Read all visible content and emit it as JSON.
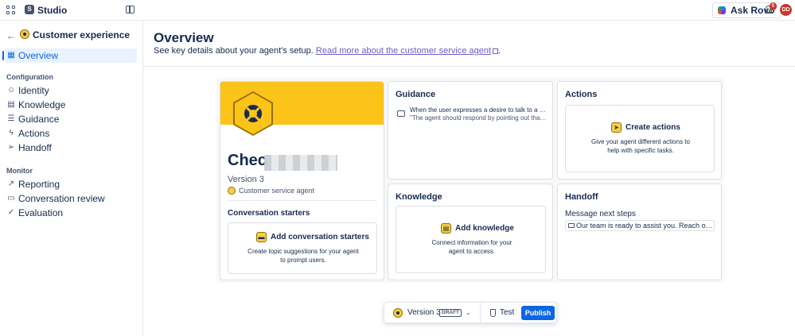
{
  "topbar": {
    "app_name": "Studio",
    "ask_rovo": "Ask Rovo",
    "notification_count": "6",
    "avatar_initials": "DD"
  },
  "sidebar": {
    "agent_name": "Customer experience",
    "overview": "Overview",
    "configuration_label": "Configuration",
    "configuration_items": [
      {
        "label": "Identity",
        "icon": "smiley-icon"
      },
      {
        "label": "Knowledge",
        "icon": "book-icon"
      },
      {
        "label": "Guidance",
        "icon": "list-icon"
      },
      {
        "label": "Actions",
        "icon": "bolt-icon"
      },
      {
        "label": "Handoff",
        "icon": "send-icon"
      }
    ],
    "monitor_label": "Monitor",
    "monitor_items": [
      {
        "label": "Reporting",
        "icon": "chart-icon"
      },
      {
        "label": "Conversation review",
        "icon": "chat-icon"
      },
      {
        "label": "Evaluation",
        "icon": "check-circle-icon"
      }
    ]
  },
  "main": {
    "title": "Overview",
    "subtitle": "See key details about your agent's setup.",
    "link_text": "Read more about the customer service agent",
    "link_suffix": "."
  },
  "profile": {
    "agent_title": "Chec",
    "version": "Version 3",
    "agent_type": "Customer service agent",
    "starters_title": "Conversation starters",
    "starters_empty_title": "Add conversation starters",
    "starters_empty_desc": "Create topic suggestions for your agent to prompt users."
  },
  "guidance": {
    "title": "Guidance",
    "item_main": "When the user expresses a desire to talk to a human",
    "item_sub": "\"The agent should respond by pointing out that it is a virtual agent\""
  },
  "actions": {
    "title": "Actions",
    "empty_title": "Create actions",
    "empty_desc": "Give your agent different actions to help with specific tasks."
  },
  "knowledge": {
    "title": "Knowledge",
    "empty_title": "Add knowledge",
    "empty_desc": "Connect information for your agent to access."
  },
  "handoff": {
    "title": "Handoff",
    "label": "Message next steps",
    "message": "Our team is ready to assist you. Reach out to us"
  },
  "bottom_bar": {
    "version": "Version 3",
    "draft": "DRAFT",
    "test": "Test",
    "publish": "Publish"
  },
  "colors": {
    "accent": "#0c66e4",
    "brand_yellow": "#fcc419",
    "danger": "#c9372c"
  }
}
